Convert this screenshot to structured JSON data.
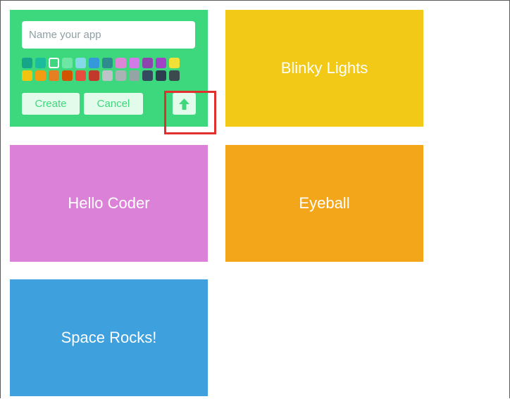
{
  "new_app": {
    "name_placeholder": "Name your app",
    "name_value": "",
    "swatches": [
      {
        "color": "#17a589",
        "selected": false
      },
      {
        "color": "#1abc9c",
        "selected": false
      },
      {
        "color": "#3dd87e",
        "selected": true
      },
      {
        "color": "#6ee7a4",
        "selected": false
      },
      {
        "color": "#85d8e8",
        "selected": false
      },
      {
        "color": "#3498db",
        "selected": false
      },
      {
        "color": "#2e8b8e",
        "selected": false
      },
      {
        "color": "#dd86d8",
        "selected": false
      },
      {
        "color": "#d27ae8",
        "selected": false
      },
      {
        "color": "#8e44ad",
        "selected": false
      },
      {
        "color": "#a243c7",
        "selected": false
      },
      {
        "color": "#f1e037",
        "selected": false
      },
      {
        "color": "#f1c40f",
        "selected": false
      },
      {
        "color": "#f39c12",
        "selected": false
      },
      {
        "color": "#e67e22",
        "selected": false
      },
      {
        "color": "#d35400",
        "selected": false
      },
      {
        "color": "#e74c3c",
        "selected": false
      },
      {
        "color": "#c0392b",
        "selected": false
      },
      {
        "color": "#bdc3c7",
        "selected": false
      },
      {
        "color": "#a9b3b5",
        "selected": false
      },
      {
        "color": "#95a5a6",
        "selected": false
      },
      {
        "color": "#34495e",
        "selected": false
      },
      {
        "color": "#2c3e50",
        "selected": false
      },
      {
        "color": "#3b4a4d",
        "selected": false
      }
    ],
    "create_label": "Create",
    "cancel_label": "Cancel",
    "upload_icon": "upload-arrow-icon",
    "tile_color": "#3dd87e",
    "button_bg": "#e3fbea",
    "highlight_color": "#e0302e"
  },
  "apps": [
    {
      "name": "Blinky Lights",
      "color": "#f2c916"
    },
    {
      "name": "Hello Coder",
      "color": "#db82d8"
    },
    {
      "name": "Eyeball",
      "color": "#f4a61b"
    },
    {
      "name": "Space Rocks!",
      "color": "#3ea0dc"
    }
  ]
}
